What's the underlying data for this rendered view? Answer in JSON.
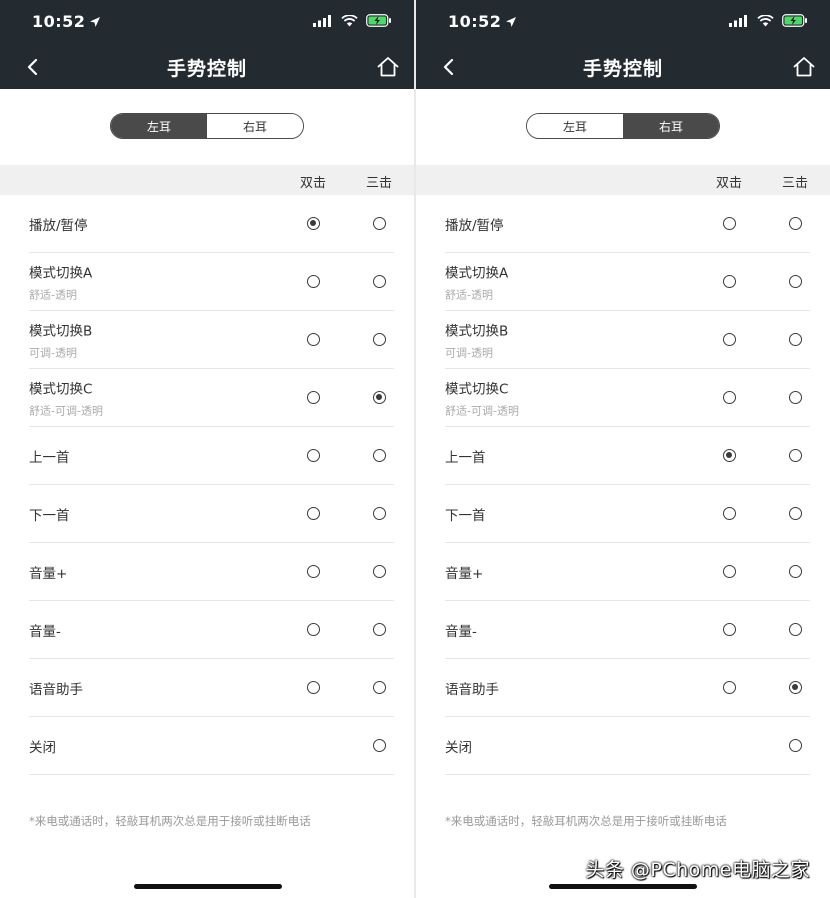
{
  "status": {
    "time": "10:52",
    "icons": [
      "location-arrow-icon",
      "signal-icon",
      "wifi-icon",
      "battery-charging-icon"
    ]
  },
  "nav": {
    "title": "手势控制",
    "back_icon": "chevron-left-icon",
    "home_icon": "home-icon"
  },
  "segment": {
    "left": "左耳",
    "right": "右耳"
  },
  "columns": {
    "double": "双击",
    "triple": "三击"
  },
  "footnote": "*来电或通话时，轻敲耳机两次总是用于接听或挂断电话",
  "watermark": "头条 @PChome电脑之家",
  "colors": {
    "header_bg": "#232a30",
    "segment_active": "#4a4a4a",
    "battery": "#4cd964"
  },
  "screens": [
    {
      "active_segment": "left",
      "rows": [
        {
          "label": "播放/暂停",
          "sub": "",
          "double": true,
          "triple": false
        },
        {
          "label": "模式切换A",
          "sub": "舒适-透明",
          "double": false,
          "triple": false
        },
        {
          "label": "模式切换B",
          "sub": "可调-透明",
          "double": false,
          "triple": false
        },
        {
          "label": "模式切换C",
          "sub": "舒适-可调-透明",
          "double": false,
          "triple": true
        },
        {
          "label": "上一首",
          "sub": "",
          "double": false,
          "triple": false
        },
        {
          "label": "下一首",
          "sub": "",
          "double": false,
          "triple": false
        },
        {
          "label": "音量+",
          "sub": "",
          "double": false,
          "triple": false
        },
        {
          "label": "音量-",
          "sub": "",
          "double": false,
          "triple": false
        },
        {
          "label": "语音助手",
          "sub": "",
          "double": false,
          "triple": false
        },
        {
          "label": "关闭",
          "sub": "",
          "double": null,
          "triple": false
        }
      ]
    },
    {
      "active_segment": "right",
      "rows": [
        {
          "label": "播放/暂停",
          "sub": "",
          "double": false,
          "triple": false
        },
        {
          "label": "模式切换A",
          "sub": "舒适-透明",
          "double": false,
          "triple": false
        },
        {
          "label": "模式切换B",
          "sub": "可调-透明",
          "double": false,
          "triple": false
        },
        {
          "label": "模式切换C",
          "sub": "舒适-可调-透明",
          "double": false,
          "triple": false
        },
        {
          "label": "上一首",
          "sub": "",
          "double": true,
          "triple": false
        },
        {
          "label": "下一首",
          "sub": "",
          "double": false,
          "triple": false
        },
        {
          "label": "音量+",
          "sub": "",
          "double": false,
          "triple": false
        },
        {
          "label": "音量-",
          "sub": "",
          "double": false,
          "triple": false
        },
        {
          "label": "语音助手",
          "sub": "",
          "double": false,
          "triple": true
        },
        {
          "label": "关闭",
          "sub": "",
          "double": null,
          "triple": false
        }
      ]
    }
  ]
}
